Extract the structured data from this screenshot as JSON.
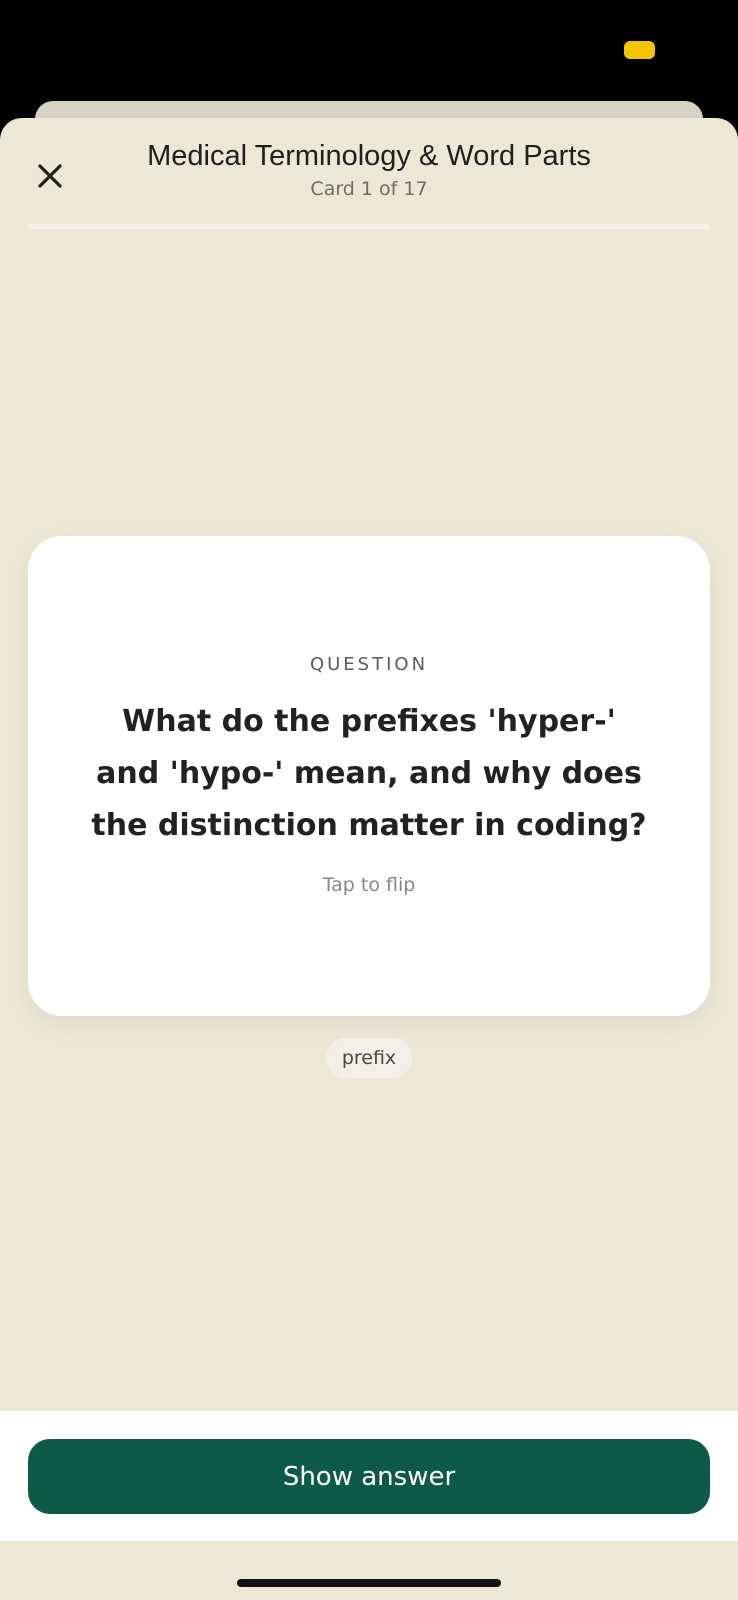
{
  "header": {
    "title": "Medical Terminology & Word Parts",
    "counter": "Card 1 of 17",
    "progress_fraction": 0.0
  },
  "card": {
    "kicker": "QUESTION",
    "question": "What do the prefixes 'hyper-' and 'hypo-' mean, and why does the distinction matter in coding?",
    "hint": "Tap to flip"
  },
  "tag": {
    "label": "prefix"
  },
  "actions": {
    "show_answer_label": "Show answer"
  },
  "icons": {
    "close": "close-icon"
  },
  "colors": {
    "background": "#EDE7D6",
    "card": "#FFFFFF",
    "primary_button": "#0E5A48",
    "status_pill": "#F5C400"
  }
}
